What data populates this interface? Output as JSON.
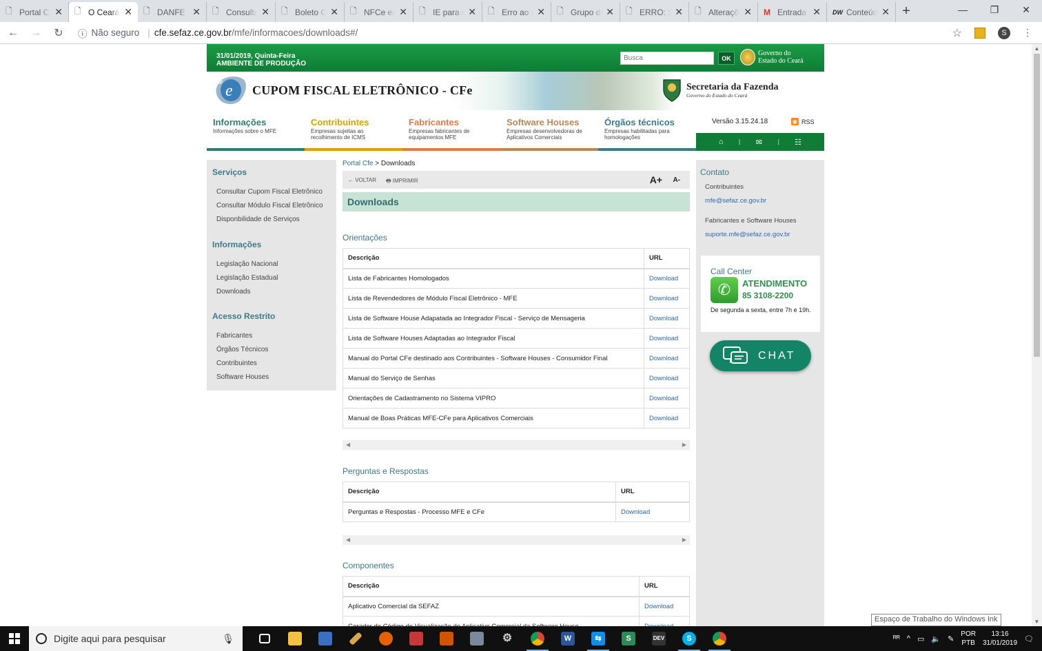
{
  "browser": {
    "tabs": [
      {
        "title": "Portal CF",
        "icon": "page-icon",
        "active": false
      },
      {
        "title": "O Ceará",
        "icon": "page-icon",
        "active": true
      },
      {
        "title": "DANFE fo",
        "icon": "page-icon",
        "active": false
      },
      {
        "title": "Consulta",
        "icon": "page-icon",
        "active": false
      },
      {
        "title": "Boleto C",
        "icon": "page-icon",
        "active": false
      },
      {
        "title": "NFCe em",
        "icon": "page-icon",
        "active": false
      },
      {
        "title": "IE para c",
        "icon": "page-icon",
        "active": false
      },
      {
        "title": "Erro ao e",
        "icon": "page-icon",
        "active": false
      },
      {
        "title": "Grupo de",
        "icon": "page-icon",
        "active": false
      },
      {
        "title": "ERRO: Sc",
        "icon": "page-icon",
        "active": false
      },
      {
        "title": "Alteraçõ",
        "icon": "page-icon",
        "active": false
      },
      {
        "title": "Entrada",
        "icon": "gmail-icon",
        "active": false
      },
      {
        "title": "Conteúd",
        "icon": "dw-icon",
        "active": false
      }
    ],
    "address": {
      "security": "Não seguro",
      "domain": "cfe.sefaz.ce.gov.br",
      "path": "/mfe/informacoes/downloads#/"
    },
    "profile_initial": "S"
  },
  "site": {
    "date": "31/01/2019, Quinta-Feira",
    "environment": "AMBIENTE DE PRODUÇÃO",
    "search_placeholder": "Busca",
    "ok_label": "OK",
    "gov_line1": "Governo do",
    "gov_line2": "Estado do Ceará",
    "title": "CUPOM FISCAL ELETRÔNICO - CFe",
    "sefaz_title": "Secretaria da Fazenda",
    "sefaz_sub": "Governo do Estado do Ceará",
    "nav": [
      {
        "title": "Informações",
        "sub": "Informações sobre o MFE",
        "color": "#2f7d6e"
      },
      {
        "title": "Contribuintes",
        "sub": "Empresas sujeitas ao recolhimento de ICMS",
        "color": "#d9a200"
      },
      {
        "title": "Fabricantes",
        "sub": "Empresas fabricantes de equipamentos MFE",
        "color": "#e07b47"
      },
      {
        "title": "Software Houses",
        "sub": "Empresas desenvolvedoras de Aplicativos Comerciais",
        "color": "#b5885a"
      },
      {
        "title": "Órgãos técnicos",
        "sub": "Empresas habilitadas para homologações",
        "color": "#3d7a88"
      }
    ],
    "version": "Versão 3.15.24.18",
    "rss": "RSS",
    "sidebar": {
      "sections": [
        {
          "title": "Serviços",
          "links": [
            "Consultar Cupom Fiscal Eletrônico",
            "Consultar Módulo Fiscal Eletrônico",
            "Disponbilidade de Serviços"
          ]
        },
        {
          "title": "Informações",
          "links": [
            "Legislação Nacional",
            "Legislação Estadual",
            "Downloads"
          ]
        },
        {
          "title": "Acesso Restrito",
          "links": [
            "Fabricantes",
            "Órgãos Técnicos",
            "Contribuintes",
            "Software Houses"
          ]
        }
      ]
    },
    "breadcrumb": {
      "root": "Portal Cfe",
      "sep": ">",
      "current": "Downloads"
    },
    "toolbar": {
      "back": "← VOLTAR",
      "print": "🖶 IMPRIMIR",
      "font_up": "A+",
      "font_down": "A-"
    },
    "page_title": "Downloads",
    "sections": [
      {
        "title": "Orientações",
        "col_desc": "Descrição",
        "col_url": "URL",
        "rows": [
          {
            "desc": "Lista de Fabricantes Homologados",
            "url": "Download"
          },
          {
            "desc": "Lista de Revendedores de Módulo Fiscal Eletrônico - MFE",
            "url": "Download"
          },
          {
            "desc": "Lista de Software House Adapatada ao Integrador Fiscal - Serviço de Mensageria",
            "url": "Download"
          },
          {
            "desc": "Lista de Software Houses Adaptadas ao Integrador Fiscal",
            "url": "Download"
          },
          {
            "desc": "Manual do Portal CFe destinado aos Contribuintes - Software Houses - Consumidor Final",
            "url": "Download"
          },
          {
            "desc": "Manual do Serviço de Senhas",
            "url": "Download"
          },
          {
            "desc": "Orientações de Cadastramento no Sistema VIPRO",
            "url": "Download"
          },
          {
            "desc": "Manual de Boas Práticas MFE-CFe para Aplicativos Comerciais",
            "url": "Download"
          }
        ]
      },
      {
        "title": "Perguntas e Respostas",
        "col_desc": "Descrição",
        "col_url": "URL",
        "rows": [
          {
            "desc": "Perguntas e Respostas - Processo MFE e CFe",
            "url": "Download"
          }
        ]
      },
      {
        "title": "Componentes",
        "col_desc": "Descrição",
        "col_url": "URL",
        "rows": [
          {
            "desc": "Aplicativo Comercial da SEFAZ",
            "url": "Download"
          },
          {
            "desc": "Gerador de Código de Visualização do Aplicativo Comercial da Software House",
            "url": "Download"
          }
        ]
      }
    ],
    "contact": {
      "title": "Contato",
      "group1_label": "Contribuintes",
      "group1_email": "mfe@sefaz.ce.gov.br",
      "group2_label": "Fabricantes e Software Houses",
      "group2_email": "suporte.mfe@sefaz.ce.gov.br"
    },
    "callcenter": {
      "title": "Call Center",
      "heading": "ATENDIMENTO",
      "phone": "85 3108-2200",
      "hours": "De segunda a sexta, entre 7h e 19h."
    },
    "chat_label": "CHAT"
  },
  "tooltip": "Espaço de Trabalho do Windows Ink",
  "taskbar": {
    "search_placeholder": "Digite aqui para pesquisar",
    "lang_line1": "POR",
    "lang_line2": "PTB",
    "time": "13:16",
    "date": "31/01/2019"
  }
}
